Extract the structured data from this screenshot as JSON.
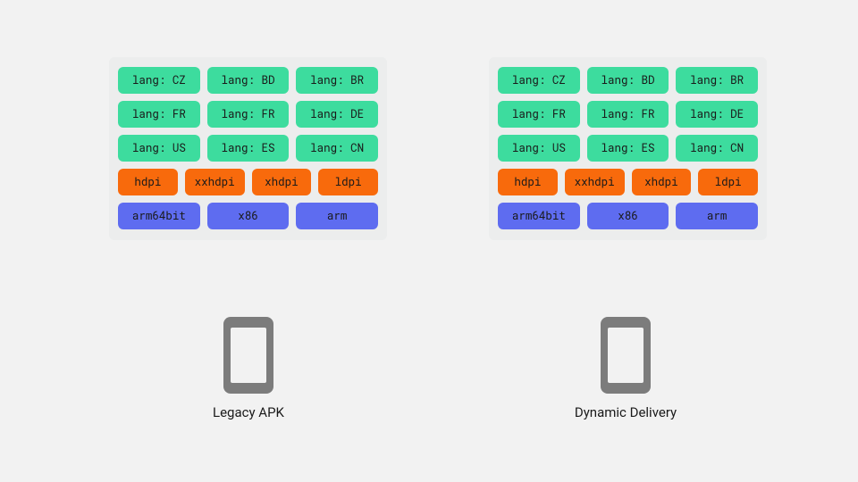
{
  "panels": {
    "left": {
      "lang_row1": [
        "lang: CZ",
        "lang: BD",
        "lang: BR"
      ],
      "lang_row2": [
        "lang: FR",
        "lang: FR",
        "lang: DE"
      ],
      "lang_row3": [
        "lang: US",
        "lang: ES",
        "lang: CN"
      ],
      "dpi_row": [
        "hdpi",
        "xxhdpi",
        "xhdpi",
        "ldpi"
      ],
      "arch_row": [
        "arm64bit",
        "x86",
        "arm"
      ]
    },
    "right": {
      "lang_row1": [
        "lang: CZ",
        "lang: BD",
        "lang: BR"
      ],
      "lang_row2": [
        "lang: FR",
        "lang: FR",
        "lang: DE"
      ],
      "lang_row3": [
        "lang: US",
        "lang: ES",
        "lang: CN"
      ],
      "dpi_row": [
        "hdpi",
        "xxhdpi",
        "xhdpi",
        "ldpi"
      ],
      "arch_row": [
        "arm64bit",
        "x86",
        "arm"
      ]
    }
  },
  "labels": {
    "left": "Legacy APK",
    "right": "Dynamic Delivery"
  },
  "colors": {
    "lang": "#3ddc9e",
    "dpi": "#f86a0c",
    "arch": "#5e6cf0",
    "panel_bg": "#eceded",
    "page_bg": "#f2f2f2"
  }
}
